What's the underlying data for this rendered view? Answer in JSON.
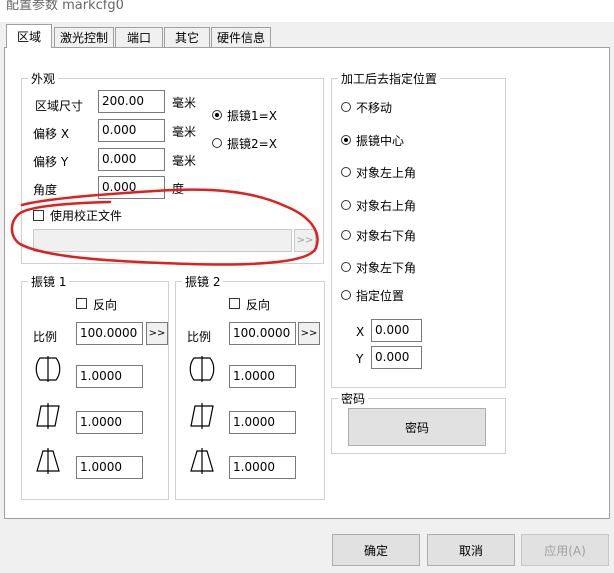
{
  "window": {
    "title": "配置参数 markcfg0"
  },
  "tabs": [
    "区域",
    "激光控制",
    "端口",
    "其它",
    "硬件信息"
  ],
  "appearance": {
    "legend": "外观",
    "area_size_label": "区域尺寸",
    "area_size_value": "200.00",
    "offset_x_label": "偏移 X",
    "offset_x_value": "0.000",
    "offset_y_label": "偏移 Y",
    "offset_y_value": "0.000",
    "angle_label": "角度",
    "angle_value": "0.000",
    "unit_mm": "毫米",
    "unit_deg": "度",
    "galvo1_x": "振镜1=X",
    "galvo2_x": "振镜2=X",
    "use_correction_file": "使用校正文件",
    "browse_btn": ">>"
  },
  "galvo1": {
    "legend": "振镜 1",
    "reverse": "反向",
    "ratio_label": "比例",
    "ratio_value": "100.0000",
    "btn": ">>",
    "v1": "1.0000",
    "v2": "1.0000",
    "v3": "1.0000"
  },
  "galvo2": {
    "legend": "振镜 2",
    "reverse": "反向",
    "ratio_label": "比例",
    "ratio_value": "100.0000",
    "btn": ">>",
    "v1": "1.0000",
    "v2": "1.0000",
    "v3": "1.0000"
  },
  "after_process": {
    "legend": "加工后去指定位置",
    "options": [
      "不移动",
      "振镜中心",
      "对象左上角",
      "对象右上角",
      "对象右下角",
      "对象左下角",
      "指定位置"
    ],
    "x_label": "X",
    "x_value": "0.000",
    "y_label": "Y",
    "y_value": "0.000"
  },
  "password": {
    "legend": "密码",
    "button": "密码"
  },
  "footer": {
    "ok": "确定",
    "cancel": "取消",
    "apply": "应用(A)"
  },
  "annotation_color": "#e02020"
}
